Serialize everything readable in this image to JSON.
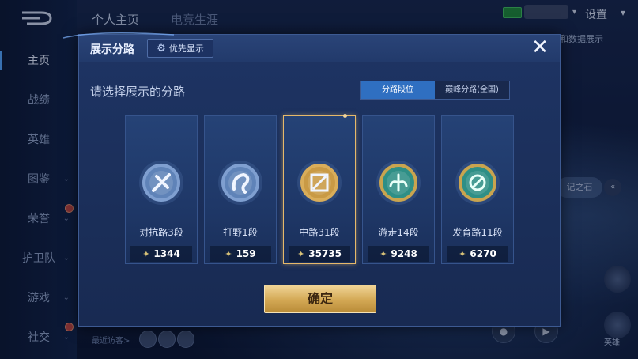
{
  "background": {
    "top_tabs": [
      "个人主页",
      "电竞生涯"
    ],
    "settings_label": "设置",
    "status_text": "",
    "right_text": "和数据展示",
    "right_pill": "记之石",
    "corner_labels": [
      "",
      "英雄"
    ],
    "recent_visitors_label": "最近访客>",
    "sidebar_items": [
      {
        "label": "主页",
        "active": true,
        "chevron": false
      },
      {
        "label": "战绩",
        "active": false,
        "chevron": false
      },
      {
        "label": "英雄",
        "active": false,
        "chevron": false
      },
      {
        "label": "图鉴",
        "active": false,
        "chevron": true
      },
      {
        "label": "荣誉",
        "active": false,
        "chevron": true
      },
      {
        "label": "护卫队",
        "active": false,
        "chevron": true
      },
      {
        "label": "游戏",
        "active": false,
        "chevron": true
      },
      {
        "label": "社交",
        "active": false,
        "chevron": true
      }
    ]
  },
  "modal": {
    "title": "展示分路",
    "priority_button": "优先显示",
    "priority_icon": "gear-icon",
    "close_icon": "close-icon",
    "prompt": "请选择展示的分路",
    "toggle": {
      "options": [
        "分路段位",
        "巅峰分路(全国)"
      ],
      "selected_index": 0
    },
    "lanes": [
      {
        "label": "对抗路3段",
        "score": "1344",
        "emblem": "clash-lane-icon",
        "selected": false,
        "accent": "#5f83b8"
      },
      {
        "label": "打野1段",
        "score": "159",
        "emblem": "jungle-icon",
        "selected": false,
        "accent": "#5f83b8"
      },
      {
        "label": "中路31段",
        "score": "35735",
        "emblem": "mid-lane-icon",
        "selected": true,
        "accent": "#c99a45"
      },
      {
        "label": "游走14段",
        "score": "9248",
        "emblem": "roam-icon",
        "selected": false,
        "accent": "#2e8f86"
      },
      {
        "label": "发育路11段",
        "score": "6270",
        "emblem": "farm-lane-icon",
        "selected": false,
        "accent": "#2e8f86"
      }
    ],
    "confirm_button": "确定"
  },
  "colors": {
    "accent_blue": "#2f6fc1",
    "gold": "#d3a854",
    "panel": "#1e3464"
  }
}
